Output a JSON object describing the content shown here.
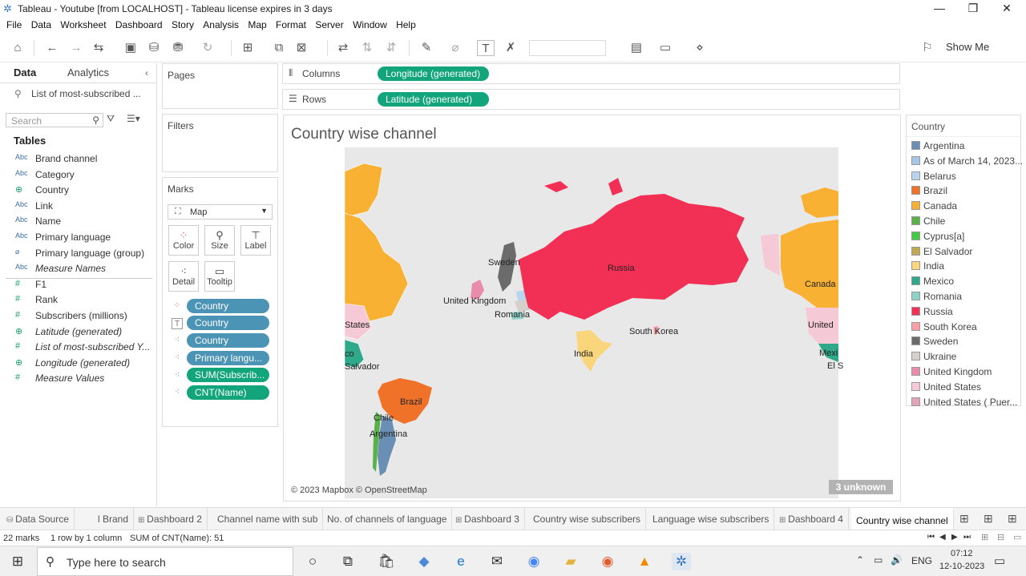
{
  "window": {
    "title": "Tableau - Youtube [from LOCALHOST] - Tableau license expires in 3 days"
  },
  "menu": [
    "File",
    "Data",
    "Worksheet",
    "Dashboard",
    "Story",
    "Analysis",
    "Map",
    "Format",
    "Server",
    "Window",
    "Help"
  ],
  "toolbar": {
    "show_me": "Show Me"
  },
  "left": {
    "tab_data": "Data",
    "tab_analytics": "Analytics",
    "datasource": "List of most-subscribed ...",
    "search_placeholder": "Search",
    "tables_label": "Tables",
    "fields": [
      {
        "type": "Abc",
        "name": "Brand channel"
      },
      {
        "type": "Abc",
        "name": "Category"
      },
      {
        "type": "globe",
        "name": "Country"
      },
      {
        "type": "Abc",
        "name": "Link"
      },
      {
        "type": "Abc",
        "name": "Name"
      },
      {
        "type": "Abc",
        "name": "Primary language"
      },
      {
        "type": "clip",
        "name": "Primary language (group)"
      },
      {
        "type": "Abc",
        "name": "Measure Names"
      },
      {
        "type": "#",
        "name": "F1"
      },
      {
        "type": "#",
        "name": "Rank"
      },
      {
        "type": "#",
        "name": "Subscribers (millions)"
      },
      {
        "type": "globe",
        "name": "Latitude (generated)"
      },
      {
        "type": "#",
        "name": "List of most-subscribed Y..."
      },
      {
        "type": "globe",
        "name": "Longitude (generated)"
      },
      {
        "type": "#",
        "name": "Measure Values"
      }
    ]
  },
  "cards": {
    "pages": "Pages",
    "filters": "Filters",
    "marks": "Marks",
    "mark_type": "Map",
    "buttons": [
      "Color",
      "Size",
      "Label",
      "Detail",
      "Tooltip"
    ],
    "pills": [
      "Country",
      "Country",
      "Country",
      "Primary langu...",
      "SUM(Subscrib...",
      "CNT(Name)"
    ]
  },
  "shelves": {
    "columns_label": "Columns",
    "columns_pill": "Longitude (generated)",
    "rows_label": "Rows",
    "rows_pill": "Latitude (generated)"
  },
  "viz": {
    "title": "Country wise channel",
    "attribution": "© 2023 Mapbox © OpenStreetMap",
    "unknown": "3 unknown",
    "labels": [
      "Sweden",
      "Russia",
      "United Kingdom",
      "Romania",
      "South Korea",
      "India",
      "Canada",
      "United",
      "States",
      "Mexi",
      "El S",
      "co",
      "Salvador",
      "Brazil",
      "Chile",
      "Argentina"
    ]
  },
  "legend": {
    "title": "Country",
    "items": [
      {
        "name": "Argentina",
        "color": "#6a8fb5"
      },
      {
        "name": "As of March 14, 2023...",
        "color": "#a7c6e6"
      },
      {
        "name": "Belarus",
        "color": "#b9d4ee"
      },
      {
        "name": "Brazil",
        "color": "#f07229"
      },
      {
        "name": "Canada",
        "color": "#f8b133"
      },
      {
        "name": "Chile",
        "color": "#58b249"
      },
      {
        "name": "Cyprus[a]",
        "color": "#43cc43"
      },
      {
        "name": "El Salvador",
        "color": "#c0a950"
      },
      {
        "name": "India",
        "color": "#f9d57b"
      },
      {
        "name": "Mexico",
        "color": "#2fa98a"
      },
      {
        "name": "Romania",
        "color": "#8fd1c8"
      },
      {
        "name": "Russia",
        "color": "#f23055"
      },
      {
        "name": "South Korea",
        "color": "#f7a1a7"
      },
      {
        "name": "Sweden",
        "color": "#6b6b6b"
      },
      {
        "name": "Ukraine",
        "color": "#d5d0cb"
      },
      {
        "name": "United Kingdom",
        "color": "#e98cab"
      },
      {
        "name": "United States",
        "color": "#f6c9d6"
      },
      {
        "name": "United States ( Puer...",
        "color": "#e3a3b8"
      }
    ]
  },
  "tabs": [
    "Data Source",
    "l Brand",
    "Dashboard 2",
    "Channel name with sub",
    "No. of channels of language",
    "Dashboard 3",
    "Country wise subscribers",
    "Language wise subscribers",
    "Dashboard 4",
    "Country wise channel"
  ],
  "status": {
    "marks": "22 marks",
    "rowscols": "1 row by 1 column",
    "sum": "SUM of CNT(Name): 51"
  },
  "taskbar": {
    "search_placeholder": "Type here to search",
    "lang": "ENG",
    "time": "07:12",
    "date": "12-10-2023"
  }
}
